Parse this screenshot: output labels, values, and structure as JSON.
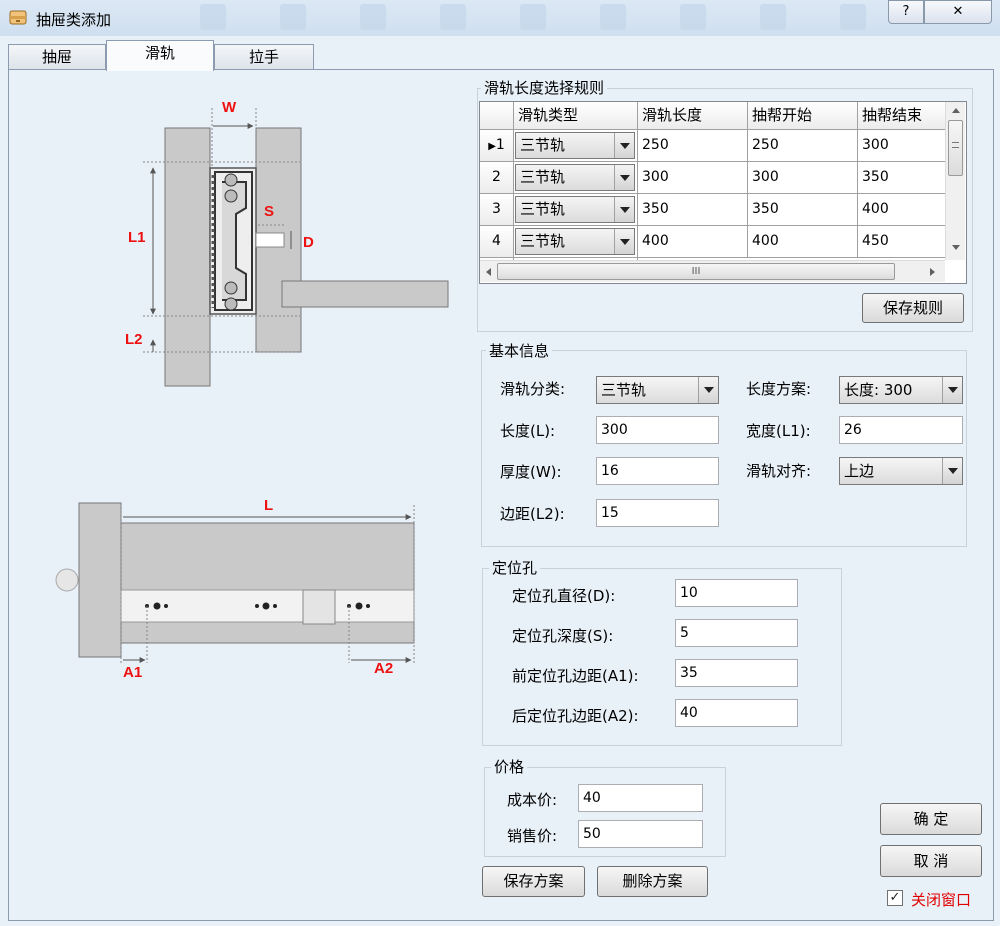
{
  "window": {
    "title": "抽屉类添加",
    "help_glyph": "?",
    "close_glyph": "✕"
  },
  "tabs": [
    {
      "label": "抽屉",
      "active": false
    },
    {
      "label": "滑轨",
      "active": true
    },
    {
      "label": "拉手",
      "active": false
    }
  ],
  "diagram_labels": {
    "w": "W",
    "s": "S",
    "d": "D",
    "l1": "L1",
    "l2": "L2",
    "l": "L",
    "a1": "A1",
    "a2": "A2",
    "dim_color": "#e11"
  },
  "rule_group": {
    "title": "滑轨长度选择规则",
    "columns": [
      "滑轨类型",
      "滑轨长度",
      "抽帮开始",
      "抽帮结束"
    ],
    "rows": [
      {
        "row_header": "1",
        "current": true,
        "type": "三节轨",
        "length": "250",
        "start": "250",
        "end": "300"
      },
      {
        "row_header": "2",
        "current": false,
        "type": "三节轨",
        "length": "300",
        "start": "300",
        "end": "350"
      },
      {
        "row_header": "3",
        "current": false,
        "type": "三节轨",
        "length": "350",
        "start": "350",
        "end": "400"
      },
      {
        "row_header": "4",
        "current": false,
        "type": "三节轨",
        "length": "400",
        "start": "400",
        "end": "450"
      }
    ],
    "hscroll_grip": "III",
    "save_rule_label": "保存规则"
  },
  "basic_info": {
    "title": "基本信息",
    "category_label": "滑轨分类:",
    "category_value": "三节轨",
    "length_scheme_label": "长度方案:",
    "length_scheme_value": "长度: 300",
    "length_label": "长度(L):",
    "length_value": "300",
    "width_label": "宽度(L1):",
    "width_value": "26",
    "thickness_label": "厚度(W):",
    "thickness_value": "16",
    "align_label": "滑轨对齐:",
    "align_value": "上边",
    "margin_label": "边距(L2):",
    "margin_value": "15"
  },
  "hole_group": {
    "title": "定位孔",
    "diameter_label": "定位孔直径(D):",
    "diameter_value": "10",
    "depth_label": "定位孔深度(S):",
    "depth_value": "5",
    "front_margin_label": "前定位孔边距(A1):",
    "front_margin_value": "35",
    "back_margin_label": "后定位孔边距(A2):",
    "back_margin_value": "40"
  },
  "price_group": {
    "title": "价格",
    "cost_label": "成本价:",
    "cost_value": "40",
    "sale_label": "销售价:",
    "sale_value": "50"
  },
  "actions": {
    "save_scheme": "保存方案",
    "delete_scheme": "删除方案",
    "ok": "确 定",
    "cancel": "取 消",
    "close_window_label": "关闭窗口",
    "close_window_checked": true,
    "check_glyph": "✓"
  }
}
